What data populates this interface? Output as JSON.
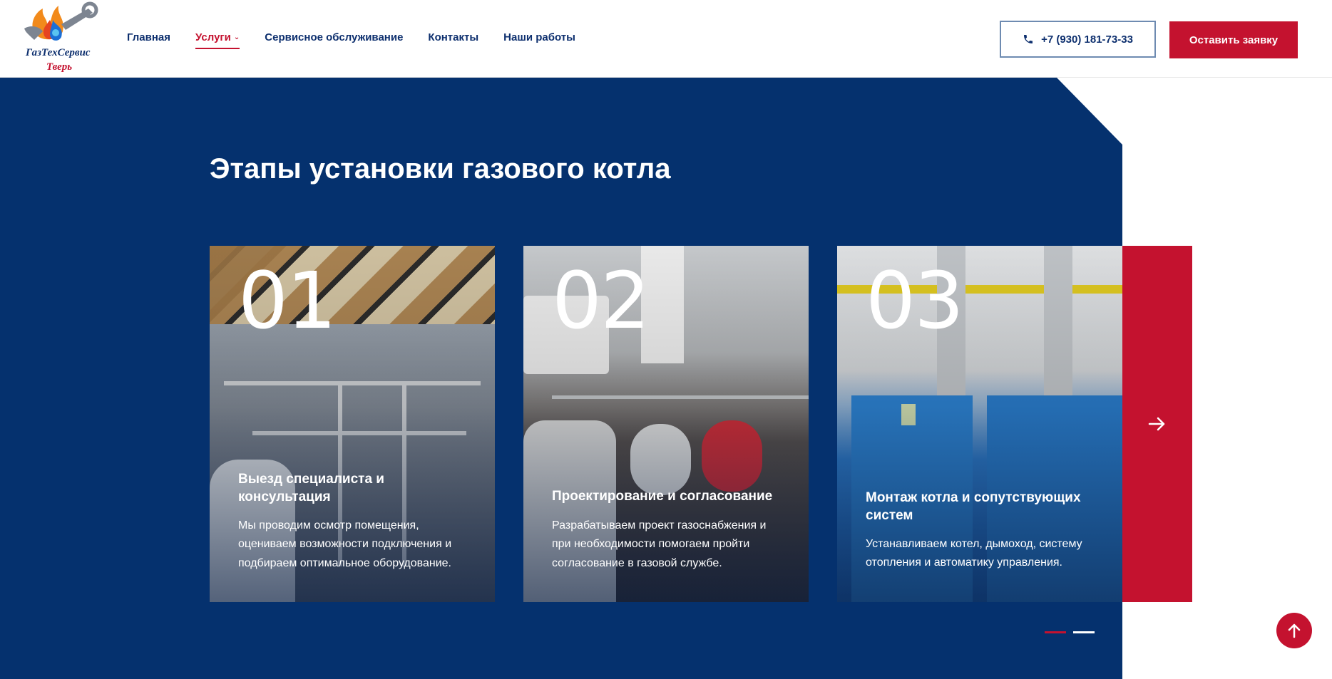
{
  "header": {
    "logo": {
      "line1": "ГазТехСервис",
      "line2": "Тверь"
    },
    "nav": [
      {
        "label": "Главная"
      },
      {
        "label": "Услуги"
      },
      {
        "label": "Сервисное обслуживание"
      },
      {
        "label": "Контакты"
      },
      {
        "label": "Наши работы"
      }
    ],
    "phone": "+7 (930) 181-73-33",
    "cta": "Оставить заявку"
  },
  "section": {
    "title": "Этапы установки газового котла",
    "cards": [
      {
        "number": "01",
        "title": "Выезд специалиста и консультация",
        "text": "Мы проводим осмотр помещения, оцениваем возможности подключения и подбираем оптимальное оборудование."
      },
      {
        "number": "02",
        "title": "Проектирование и согласование",
        "text": "Разрабатываем проект газоснабжения и при необходимости помогаем пройти согласование в газовой службе."
      },
      {
        "number": "03",
        "title": "Монтаж котла и сопутствующих систем",
        "text": "Устанавливаем котел, дымоход, систему отопления и автоматику управления."
      }
    ]
  },
  "colors": {
    "primary": "#05316e",
    "accent": "#c4122f"
  },
  "icons": {
    "phone": "phone-icon",
    "next": "arrow-right-icon",
    "top": "arrow-up-icon"
  }
}
